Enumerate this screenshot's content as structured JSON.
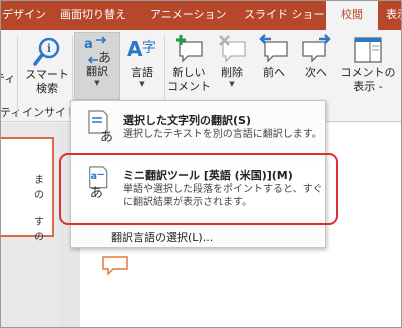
{
  "tabs": [
    {
      "label": "デザイン",
      "active": false
    },
    {
      "label": "画面切り替え",
      "active": false
    },
    {
      "label": "アニメーション",
      "active": false
    },
    {
      "label": "スライド ショー",
      "active": false
    },
    {
      "label": "校閲",
      "active": true
    },
    {
      "label": "表示",
      "active": false
    }
  ],
  "ribbon": {
    "left_partial": "ティ",
    "smart_lookup": {
      "line1": "スマート",
      "line2": "検索"
    },
    "translate": "翻訳",
    "language": "言語",
    "new_comment": {
      "line1": "新しい",
      "line2": "コメント"
    },
    "delete": "削除",
    "previous": "前へ",
    "next": "次へ",
    "show_comments": {
      "line1": "コメントの",
      "line2": "表示 -"
    },
    "group_left_partial": "ティ",
    "group_insights": "インサイト"
  },
  "menu": {
    "item1": {
      "title": "選択した文字列の翻訳(S)",
      "desc": "選択したテキストを別の言語に翻訳します。"
    },
    "item2": {
      "title": "ミニ翻訳ツール [英語 (米国)](M)",
      "desc": "単語や選択した段落をポイントすると、すぐに翻訳結果が表示されます。"
    },
    "footer": "翻訳言語の選択(L)..."
  },
  "thumb_text": {
    "a": "ま の",
    "b": "す の"
  },
  "colors": {
    "ribbon_tab_bar": "#b7472a",
    "highlight": "#d9312f"
  }
}
